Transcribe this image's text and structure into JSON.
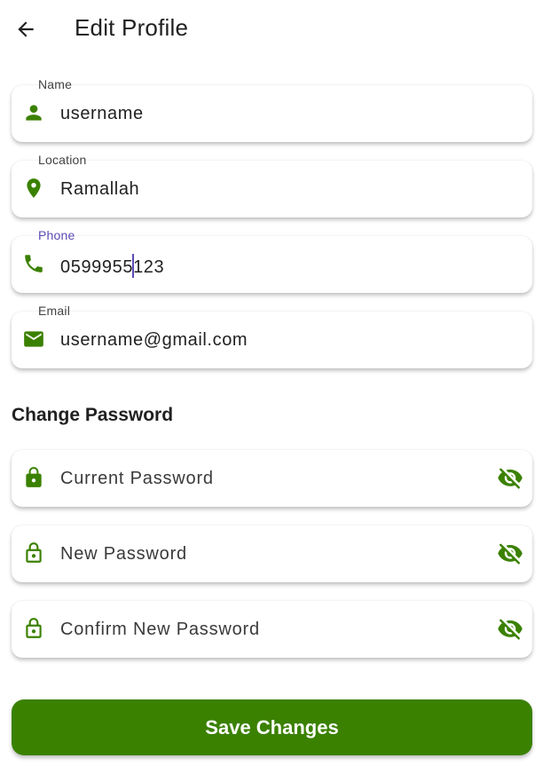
{
  "header": {
    "back_icon": "arrow-back-icon",
    "title": "Edit Profile"
  },
  "colors": {
    "accent_green": "#3b8100",
    "focus_purple": "#5b4bb5",
    "text": "#212121"
  },
  "profile_fields": [
    {
      "label": "Name",
      "value": "username",
      "icon": "person-icon",
      "focused": false
    },
    {
      "label": "Location",
      "value": "Ramallah",
      "icon": "location-pin-icon",
      "focused": false
    },
    {
      "label": "Phone",
      "value_before_caret": "0599955",
      "value_after_caret": "123",
      "icon": "phone-icon",
      "focused": true
    },
    {
      "label": "Email",
      "value": "username@gmail.com",
      "icon": "mail-icon",
      "focused": false
    }
  ],
  "password_section": {
    "title": "Change Password",
    "fields": [
      {
        "placeholder": "Current Password",
        "icon": "lock-filled-icon",
        "toggle_icon": "visibility-off-icon"
      },
      {
        "placeholder": "New Password",
        "icon": "lock-outline-icon",
        "toggle_icon": "visibility-off-icon"
      },
      {
        "placeholder": "Confirm New Password",
        "icon": "lock-outline-icon",
        "toggle_icon": "visibility-off-icon"
      }
    ]
  },
  "save_button": {
    "label": "Save Changes"
  }
}
